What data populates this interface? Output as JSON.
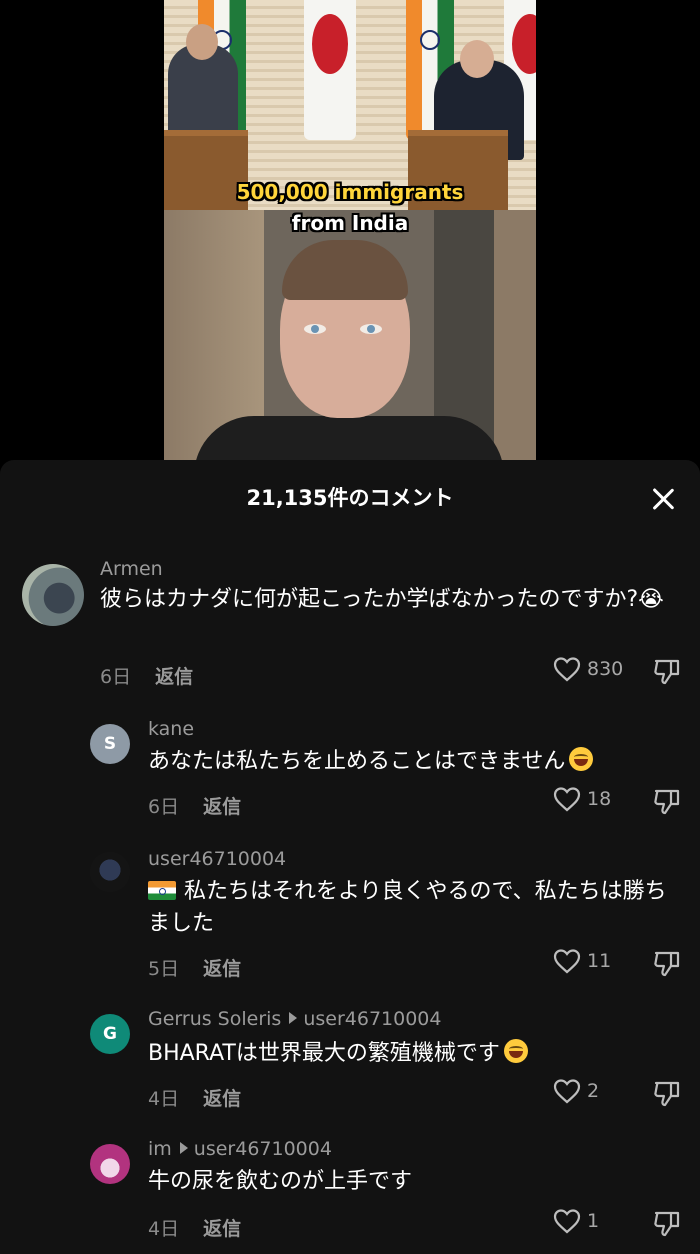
{
  "video": {
    "caption_line1": "500,000 immigrants",
    "caption_line2": "from India"
  },
  "sheet": {
    "title": "21,135件のコメント",
    "close_icon": "close-icon"
  },
  "comments": [
    {
      "username": "Armen",
      "text": "彼らはカナダに何が起こったか学ばなかったのですか?😭",
      "age": "6日",
      "reply_label": "返信",
      "likes": "830"
    },
    {
      "username": "kane",
      "avatar_letter": "S",
      "avatar_color": "#8e9aa6",
      "text": "あなたは私たちを止めることはできません",
      "age": "6日",
      "reply_label": "返信",
      "likes": "18"
    },
    {
      "username": "user46710004",
      "text": "私たちはそれをより良くやるので、私たちは勝ちました",
      "age": "5日",
      "reply_label": "返信",
      "likes": "11"
    },
    {
      "username": "Gerrus Soleris",
      "reply_to": "user46710004",
      "avatar_letter": "G",
      "avatar_color": "#0f8a78",
      "text": "BHARATは世界最大の繁殖機械です",
      "age": "4日",
      "reply_label": "返信",
      "likes": "2"
    },
    {
      "username": "im",
      "reply_to": "user46710004",
      "text": "牛の尿を飲むのが上手です",
      "age": "4日",
      "reply_label": "返信",
      "likes": "1"
    }
  ]
}
